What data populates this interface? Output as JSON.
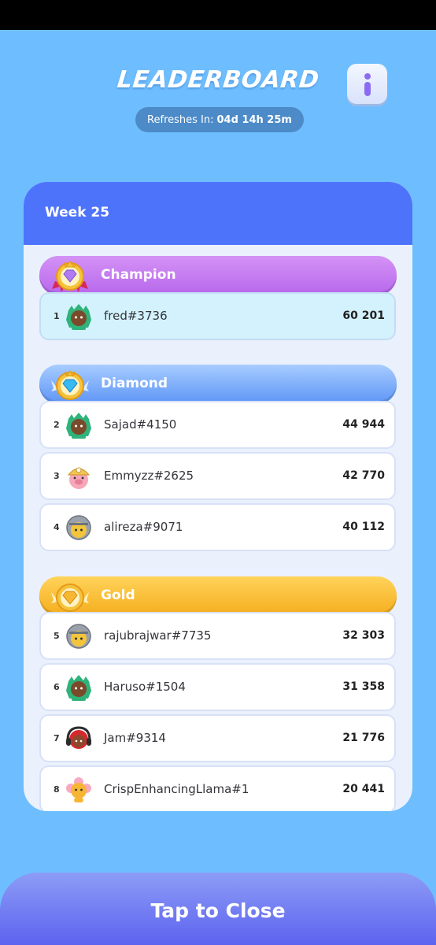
{
  "header": {
    "title": "LEADERBOARD",
    "refresh_label": "Refreshes In:",
    "refresh_time": "04d 14h 25m",
    "info_icon": "info-icon"
  },
  "week_label": "Week 25",
  "leagues": [
    {
      "name": "Champion",
      "icon": "champion-badge-icon"
    },
    {
      "name": "Diamond",
      "icon": "diamond-badge-icon"
    },
    {
      "name": "Gold",
      "icon": "gold-badge-icon"
    }
  ],
  "players": [
    {
      "rank": "1",
      "name": "fred#3736",
      "score": "60 201",
      "avatar": "dino-avatar-icon",
      "highlighted": true
    },
    {
      "rank": "2",
      "name": "Sajad#4150",
      "score": "44 944",
      "avatar": "dino-avatar-icon"
    },
    {
      "rank": "3",
      "name": "Emmyzz#2625",
      "score": "42 770",
      "avatar": "pig-miner-avatar-icon"
    },
    {
      "rank": "4",
      "name": "alireza#9071",
      "score": "40 112",
      "avatar": "knight-avatar-icon"
    },
    {
      "rank": "5",
      "name": "rajubrajwar#7735",
      "score": "32 303",
      "avatar": "knight-avatar-icon"
    },
    {
      "rank": "6",
      "name": "Haruso#1504",
      "score": "31 358",
      "avatar": "dino-avatar-icon"
    },
    {
      "rank": "7",
      "name": "Jam#9314",
      "score": "21 776",
      "avatar": "headphones-avatar-icon"
    },
    {
      "rank": "8",
      "name": "CrispEnhancingLlama#1",
      "score": "20 441",
      "avatar": "flower-avatar-icon"
    }
  ],
  "close_label": "Tap to Close",
  "colors": {
    "background": "#6ebeff",
    "card_header": "#4e73fb",
    "champion": "#c47cf0",
    "diamond": "#6fa3f8",
    "gold": "#f7b731"
  }
}
